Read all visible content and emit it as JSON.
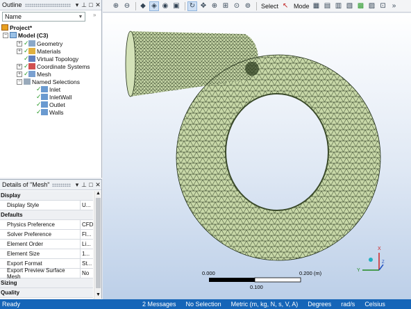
{
  "outline": {
    "title": "Outline",
    "name_filter": "Name",
    "tree": {
      "project": "Project*",
      "model": "Model (C3)",
      "children": [
        "Geometry",
        "Materials",
        "Virtual Topology",
        "Coordinate Systems",
        "Mesh",
        "Named Selections"
      ],
      "named_selections": [
        "Inlet",
        "InletWall",
        "Outlet",
        "Walls"
      ]
    }
  },
  "details": {
    "title": "Details of \"Mesh\"",
    "rows": [
      {
        "type": "section",
        "label": "Display"
      },
      {
        "type": "prop",
        "label": "Display Style",
        "value": "U..."
      },
      {
        "type": "section",
        "label": "Defaults"
      },
      {
        "type": "prop",
        "label": "Physics Preference",
        "value": "CFD"
      },
      {
        "type": "prop",
        "label": "Solver Preference",
        "value": "Fl..."
      },
      {
        "type": "prop",
        "label": "Element Order",
        "value": "Li..."
      },
      {
        "type": "prop",
        "label": "Element Size",
        "value": "1..."
      },
      {
        "type": "prop",
        "label": "Export Format",
        "value": "St..."
      },
      {
        "type": "prop",
        "label": "Export Preview Surface Mesh",
        "value": "No"
      },
      {
        "type": "section",
        "label": "Sizing"
      },
      {
        "type": "section",
        "label": "Quality"
      }
    ]
  },
  "toolbar": {
    "select_label": "Select",
    "mode_label": "Mode"
  },
  "viewport": {
    "scale_left": "0.000",
    "scale_right": "0.200 (m)",
    "scale_mid": "0.100",
    "axis_x": "X",
    "axis_y": "Y",
    "axis_z": "Z",
    "mesh_color": "#c8d8a8"
  },
  "status": {
    "ready": "Ready",
    "messages": "2 Messages",
    "selection": "No Selection",
    "units": "Metric (m, kg, N, s, V, A)",
    "angle": "Degrees",
    "rate": "rad/s",
    "temp": "Celsius"
  }
}
